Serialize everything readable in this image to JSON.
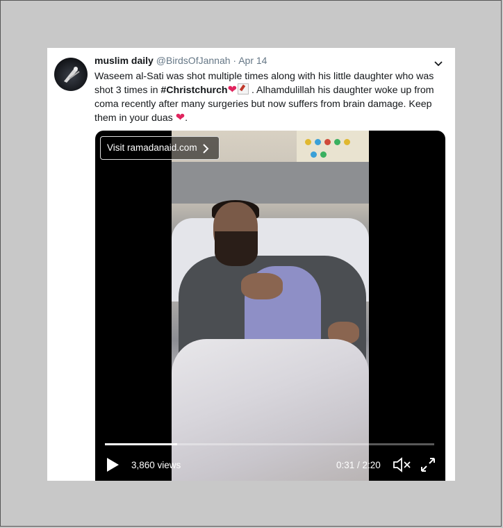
{
  "tweet": {
    "display_name": "muslim daily",
    "handle": "@BirdsOfJannah",
    "separator": "·",
    "date": "Apr 14",
    "text_part1": "Waseem al-Sati was shot multiple times along with his little daughter who was shot 3 times in ",
    "hashtag": "#Christchurch",
    "emoji_heart_1": "❤",
    "text_part2": " . Alhamdulillah his daughter woke up from coma recently after many surgeries but now suffers from brain damage. Keep them in your duas ",
    "emoji_heart_2": "❤",
    "text_end": "."
  },
  "video": {
    "ad_label": "Visit ramadanaid.com",
    "views": "3,860 views",
    "time": "0:31 / 2:20",
    "progress": 0.22
  },
  "icons": {
    "caret": "chevron-down-icon",
    "play": "play-icon",
    "mute": "volume-muted-icon",
    "expand": "expand-icon",
    "ad_arrow": "chevron-right-icon"
  },
  "colors": {
    "heart": "#e0245e",
    "muted_text": "#657786",
    "text": "#14171a"
  }
}
